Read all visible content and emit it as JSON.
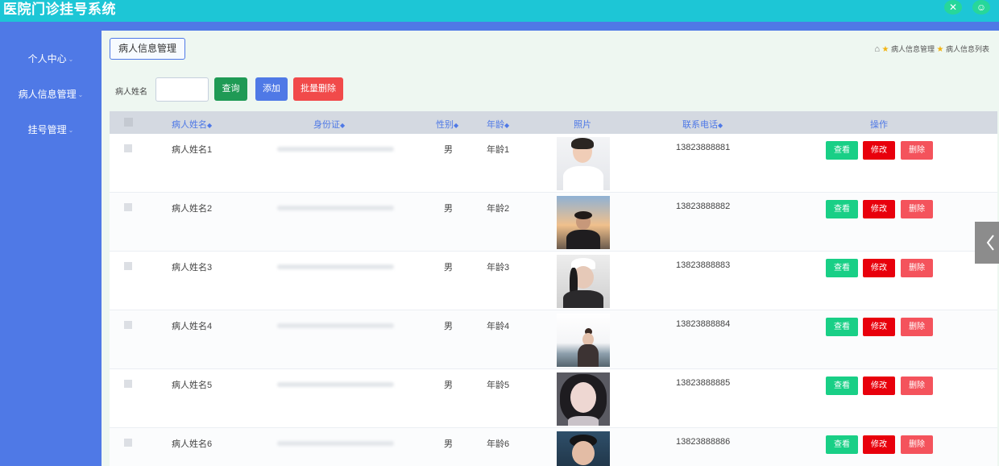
{
  "header": {
    "title": "医院门诊挂号系统"
  },
  "sidebar": {
    "items": [
      {
        "label": "个人中心"
      },
      {
        "label": "病人信息管理"
      },
      {
        "label": "挂号管理"
      }
    ]
  },
  "page": {
    "tab_label": "病人信息管理",
    "breadcrumb": [
      "病人信息管理",
      "病人信息列表"
    ]
  },
  "search": {
    "label": "病人姓名",
    "value": "",
    "placeholder": "",
    "query_label": "查询",
    "add_label": "添加",
    "batch_delete_label": "批量删除"
  },
  "table": {
    "columns": [
      "病人姓名",
      "身份证",
      "性别",
      "年龄",
      "照片",
      "联系电话",
      "操作"
    ],
    "action_labels": {
      "view": "查看",
      "edit": "修改",
      "delete": "删除"
    },
    "rows": [
      {
        "name": "病人姓名1",
        "gender": "男",
        "age": "年龄1",
        "phone": "13823888881"
      },
      {
        "name": "病人姓名2",
        "gender": "男",
        "age": "年龄2",
        "phone": "13823888882"
      },
      {
        "name": "病人姓名3",
        "gender": "男",
        "age": "年龄3",
        "phone": "13823888883"
      },
      {
        "name": "病人姓名4",
        "gender": "男",
        "age": "年龄4",
        "phone": "13823888884"
      },
      {
        "name": "病人姓名5",
        "gender": "男",
        "age": "年龄5",
        "phone": "13823888885"
      },
      {
        "name": "病人姓名6",
        "gender": "男",
        "age": "年龄6",
        "phone": "13823888886"
      }
    ]
  },
  "colors": {
    "header": "#1dc6d6",
    "sidebar": "#4f79e6",
    "view_button": "#19cf86",
    "edit_button": "#e8000c",
    "delete_button": "#f4535c"
  },
  "icons": [
    "home-icon",
    "star-icon",
    "collapse-chevron-icon",
    "settings-icon",
    "user-icon"
  ]
}
